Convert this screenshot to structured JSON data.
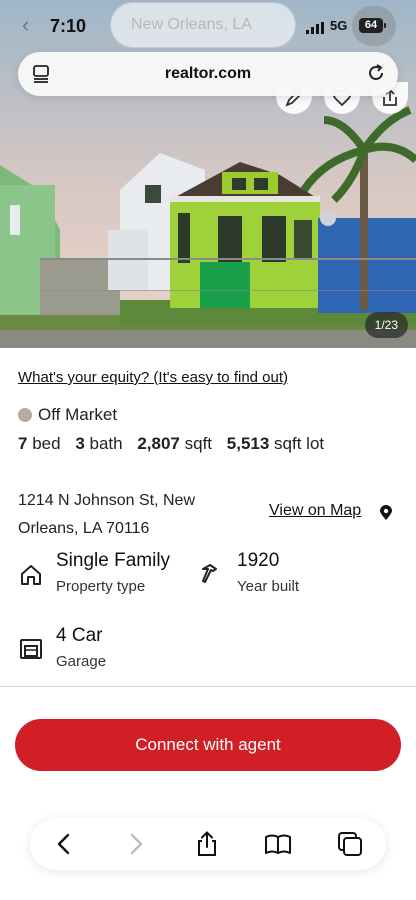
{
  "status_bar": {
    "time": "7:10",
    "network": "5G",
    "battery": "64"
  },
  "ghost_search": {
    "text": "New Orleans, LA"
  },
  "browser": {
    "url": "realtor.com"
  },
  "gallery": {
    "counter": "1/23"
  },
  "listing": {
    "equity_link": "What's your equity? (It's easy to find out)",
    "status": "Off Market",
    "beds_value": "7",
    "beds_label": "bed",
    "baths_value": "3",
    "baths_label": "bath",
    "sqft_value": "2,807",
    "sqft_label": "sqft",
    "lot_value": "5,513",
    "lot_label": "sqft lot",
    "address_line1": "1214 N Johnson St, New",
    "address_line2": "Orleans, LA 70116",
    "view_map": "View on Map",
    "facts": [
      {
        "value": "Single Family",
        "label": "Property type",
        "icon": "house-icon"
      },
      {
        "value": "1920",
        "label": "Year built",
        "icon": "hammer-icon"
      },
      {
        "value": "4 Car",
        "label": "Garage",
        "icon": "garage-icon"
      }
    ],
    "cta": "Connect with agent"
  },
  "toolbar": {
    "icons": [
      "back-icon",
      "forward-icon",
      "share-icon",
      "bookmarks-icon",
      "tabs-icon"
    ]
  },
  "colors": {
    "brand_red": "#d21f26",
    "status_dot": "#b9ab9a"
  }
}
